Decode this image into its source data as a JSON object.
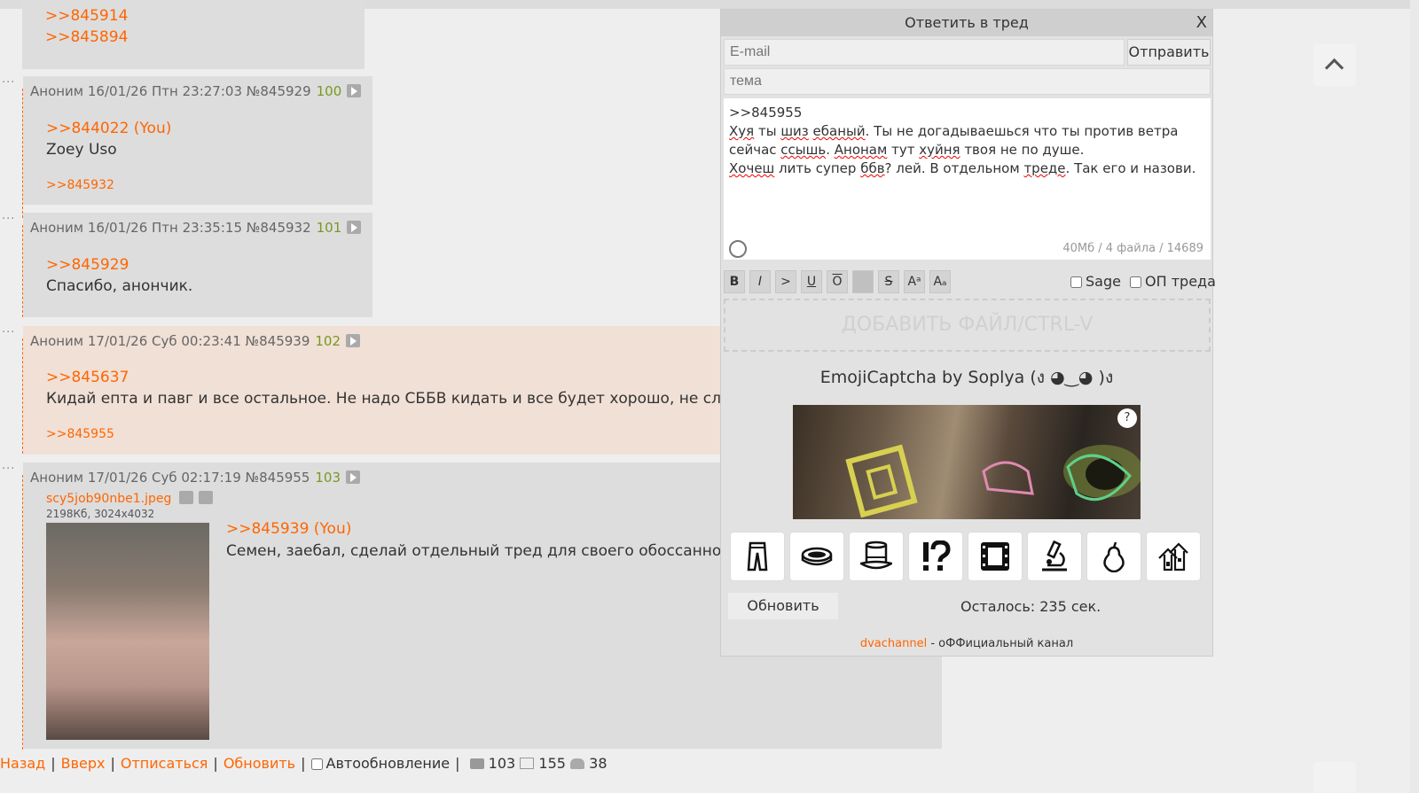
{
  "posts": [
    {
      "header": "Аноним 16/01/26 Птн 23:27:03 №845929",
      "number": "100",
      "quote": ">>844022 (You)",
      "text": "Zoey Uso",
      "replies": ">>845932"
    },
    {
      "header": "Аноним 16/01/26 Птн 23:35:15 №845932",
      "number": "101",
      "quote": ">>845929",
      "text": "Спасибо, анончик.",
      "replies": ""
    },
    {
      "header": "Аноним 17/01/26 Суб 00:23:41 №845939",
      "number": "102",
      "quote": ">>845637",
      "text": "Кидай епта и павг и все остальное. Не надо СББВ кидать и все будет хорошо, не слушай",
      "replies": ">>845955"
    },
    {
      "header": "Аноним 17/01/26 Суб 02:17:19 №845955",
      "number": "103",
      "file_name": "scy5job90nbe1.jpeg",
      "file_meta": "2198Кб, 3024x4032",
      "quote": ">>845939 (You)",
      "text": "Семен, заебал, сделай отдельный тред для своего обоссанного т"
    }
  ],
  "top_links": [
    ">>845914",
    ">>845894"
  ],
  "bottom_nav": {
    "back": "Назад",
    "up": "Вверх",
    "unsubscribe": "Отписаться",
    "refresh": "Обновить",
    "autoupdate": "Автообновление",
    "posts_count": "103",
    "images_count": "155",
    "posters_count": "38"
  },
  "reply_form": {
    "title": "Ответить в тред",
    "close": "X",
    "email_placeholder": "E-mail",
    "submit": "Отправить",
    "subject_placeholder": "тема",
    "message": {
      "line1": ">>845955",
      "line2a": "Хуя",
      "line2b": " ты ",
      "line2c": "шиз",
      "line2d": " ",
      "line2e": "ебаный",
      "line2f": ". Ты не догадываешься что ты против ветра",
      "line3a": "сейчас ",
      "line3b": "ссышь",
      "line3c": ". ",
      "line3d": "Анонам",
      "line3e": " тут ",
      "line3f": "хуйня",
      "line3g": " твоя не по душе.",
      "line4a": "Хочеш",
      "line4b": " лить супер ",
      "line4c": "ббв",
      "line4d": "? лей. В отдельном ",
      "line4e": "треде",
      "line4f": ". Так его и назови."
    },
    "counter": "40Мб / 4 файла / 14689",
    "format_buttons": [
      "B",
      "I",
      ">",
      "U",
      "O",
      "",
      "S",
      "Aᵃ",
      "Aₐ"
    ],
    "sage": "Sage",
    "op": "ОП треда",
    "dropzone": "ДОБАВИТЬ ФАЙЛ/CTRL-V",
    "captcha_title": "EmojiCaptcha by Soplya (ง ◕‿◕ )ง",
    "captcha_help": "?",
    "captcha_options": [
      "trousers-icon",
      "petri-dish-icon",
      "top-hat-icon",
      "interrobang-icon",
      "film-frame-icon",
      "microscope-icon",
      "pear-icon",
      "houses-icon"
    ],
    "refresh": "Обновить",
    "timer": "Осталось: 235 сек.",
    "footer_link": "dvachannel",
    "footer_text": " - оФФициальный канал"
  }
}
